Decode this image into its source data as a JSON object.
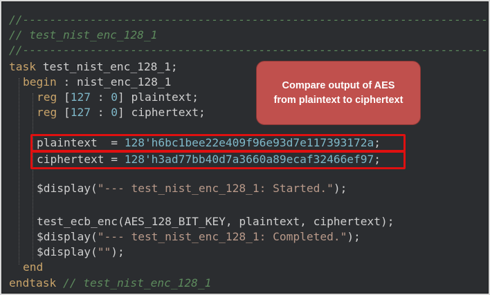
{
  "code": {
    "separator": "//---------------------------------------------------------------------------------",
    "header_comment": "// test_nist_enc_128_1",
    "task_kw": "task",
    "task_name": " test_nist_enc_128_1;",
    "begin_kw": "begin",
    "begin_label": " : nist_enc_128_1",
    "reg_kw": "reg",
    "reg_range_open": " [",
    "reg_msb": "127",
    "reg_colon": " : ",
    "reg_lsb": "0",
    "reg_range_close": "] ",
    "reg_plaintext_name": "plaintext;",
    "reg_ciphertext_name": "ciphertext;",
    "plaintext_lhs": "plaintext  = ",
    "plaintext_value": "128'h6bc1bee22e409f96e93d7e117393172a",
    "plaintext_semi": ";",
    "ciphertext_lhs": "ciphertext = ",
    "ciphertext_value": "128'h3ad77bb40d7a3660a89ecaf32466ef97",
    "ciphertext_semi": ";",
    "display_fn": "$display(",
    "display_started_str": "\"--- test_nist_enc_128_1: Started.\"",
    "display_close": ");",
    "call_line": "test_ecb_enc(AES_128_BIT_KEY, plaintext, ciphertext);",
    "display_completed_str": "\"--- test_nist_enc_128_1: Completed.\"",
    "display_empty_str": "\"\"",
    "end_kw": "end",
    "endtask_kw": "endtask",
    "endtask_comment": " // test_nist_enc_128_1"
  },
  "callout": {
    "text": "Compare output of AES from plaintext to ciphertext"
  },
  "colors": {
    "background": "#2b2d30",
    "comment": "#5d8a5d",
    "keyword": "#c9a46a",
    "number": "#7fb8c9",
    "highlight_border": "#e01010",
    "callout_fill": "#c0504d"
  }
}
